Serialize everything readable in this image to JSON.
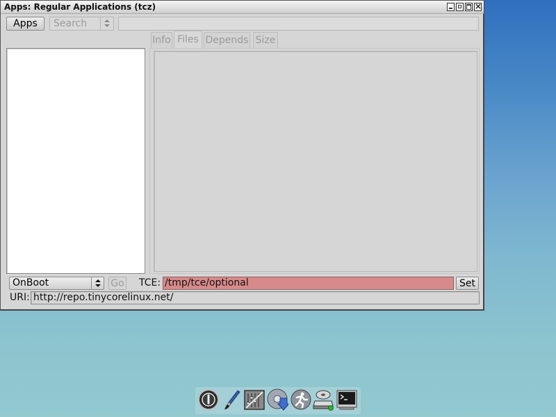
{
  "window": {
    "title": "Apps: Regular Applications (tcz)",
    "controls": [
      "minimize-icon",
      "restore-icon",
      "maximize-icon",
      "close-icon"
    ]
  },
  "toolbar": {
    "apps_label": "Apps",
    "search_mode": "Search",
    "search_value": ""
  },
  "tabs": [
    {
      "label": "Info",
      "active": false
    },
    {
      "label": "Files",
      "active": true
    },
    {
      "label": "Depends",
      "active": false
    },
    {
      "label": "Size",
      "active": false
    }
  ],
  "footer": {
    "mode_value": "OnBoot",
    "go_label": "Go",
    "tce_label": "TCE:",
    "tce_value": "/tmp/tce/optional",
    "set_label": "Set",
    "uri_label": "URI:",
    "uri_value": "http://repo.tinycorelinux.net/"
  },
  "colors": {
    "tce_field_bg": "#d88a8b",
    "window_bg": "#d6d6d6"
  },
  "dock": {
    "icons": [
      "power-icon",
      "paint-brush-icon",
      "control-panel-icon",
      "install-app-icon",
      "run-icon",
      "mount-drive-icon",
      "terminal-icon"
    ]
  }
}
